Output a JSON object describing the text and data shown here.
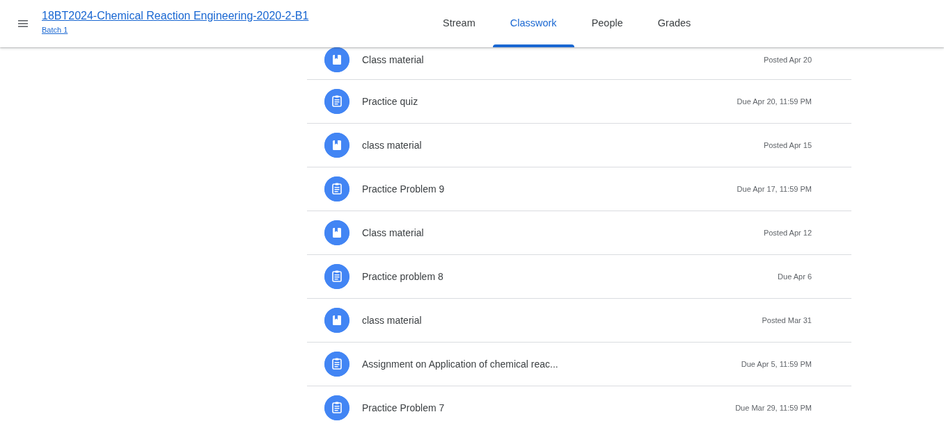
{
  "header": {
    "title": "18BT2024-Chemical Reaction Engineering-2020-2-B1",
    "subtitle": "Batch 1"
  },
  "tabs": [
    {
      "label": "Stream",
      "selected": false
    },
    {
      "label": "Classwork",
      "selected": true
    },
    {
      "label": "People",
      "selected": false
    },
    {
      "label": "Grades",
      "selected": false
    }
  ],
  "classwork": [
    {
      "kind": "material",
      "title": "Class material",
      "date": "Posted Apr 20"
    },
    {
      "kind": "assignment",
      "title": "Practice quiz",
      "date": "Due Apr 20, 11:59 PM"
    },
    {
      "kind": "material",
      "title": "class material",
      "date": "Posted Apr 15"
    },
    {
      "kind": "assignment",
      "title": "Practice Problem 9",
      "date": "Due Apr 17, 11:59 PM"
    },
    {
      "kind": "material",
      "title": "Class material",
      "date": "Posted Apr 12"
    },
    {
      "kind": "assignment",
      "title": "Practice problem 8",
      "date": "Due Apr 6"
    },
    {
      "kind": "material",
      "title": "class material",
      "date": "Posted Mar 31"
    },
    {
      "kind": "assignment",
      "title": "Assignment on Application of chemical reac...",
      "date": "Due Apr 5, 11:59 PM"
    },
    {
      "kind": "assignment",
      "title": "Practice Problem 7",
      "date": "Due Mar 29, 11:59 PM"
    }
  ]
}
